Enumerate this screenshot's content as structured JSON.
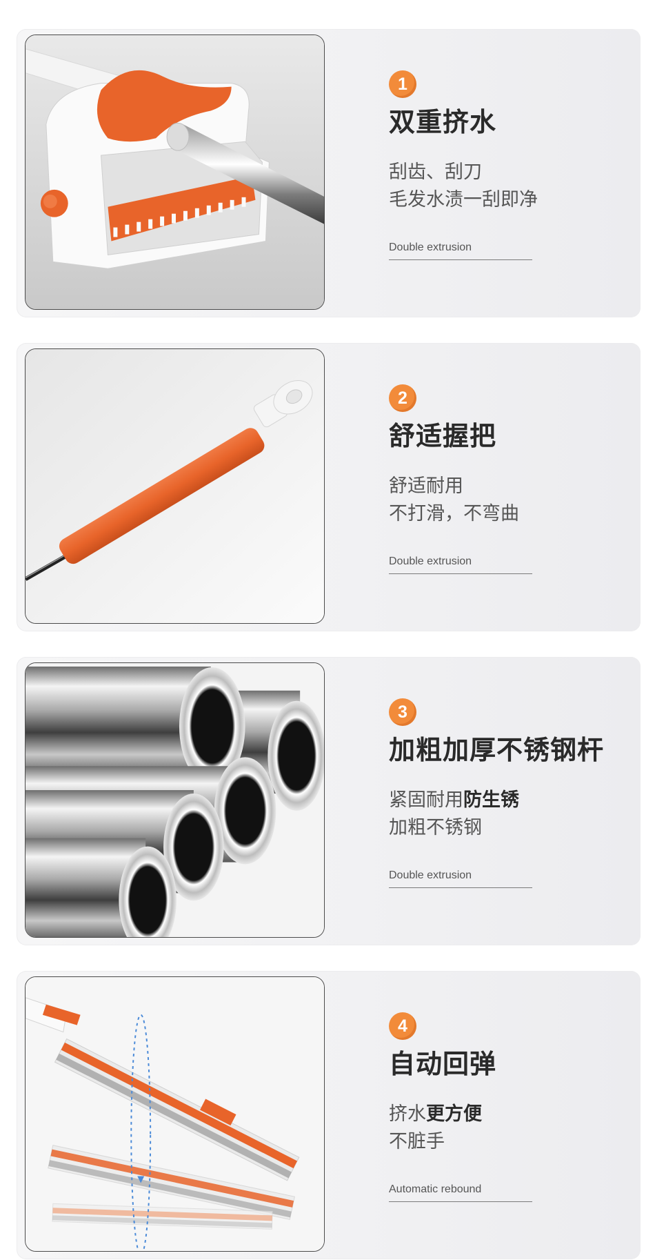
{
  "colors": {
    "accent": "#f28b3a",
    "orange_part": "#e8642a",
    "card_bg": "#f1f1f3"
  },
  "features": [
    {
      "number": "1",
      "title": "双重挤水",
      "desc_line1": "刮齿、刮刀",
      "desc_line2": "毛发水渍一刮即净",
      "caption": "Double extrusion",
      "image": "mop-squeeze-head-photo"
    },
    {
      "number": "2",
      "title": "舒适握把",
      "desc_line1": "舒适耐用",
      "desc_line2": "不打滑，不弯曲",
      "caption": "Double extrusion",
      "image": "orange-grip-handle-photo"
    },
    {
      "number": "3",
      "title": "加粗加厚不锈钢杆",
      "desc_line1_normal": "紧固耐用",
      "desc_line1_bold": "防生锈",
      "desc_line2": "加粗不锈钢",
      "caption": "Double extrusion",
      "image": "stainless-steel-tubes-photo"
    },
    {
      "number": "4",
      "title": "自动回弹",
      "desc_line1_normal": "挤水",
      "desc_line1_bold": "更方便",
      "desc_line2": "不脏手",
      "caption": "Automatic rebound",
      "image": "mop-head-rebound-photo"
    }
  ]
}
